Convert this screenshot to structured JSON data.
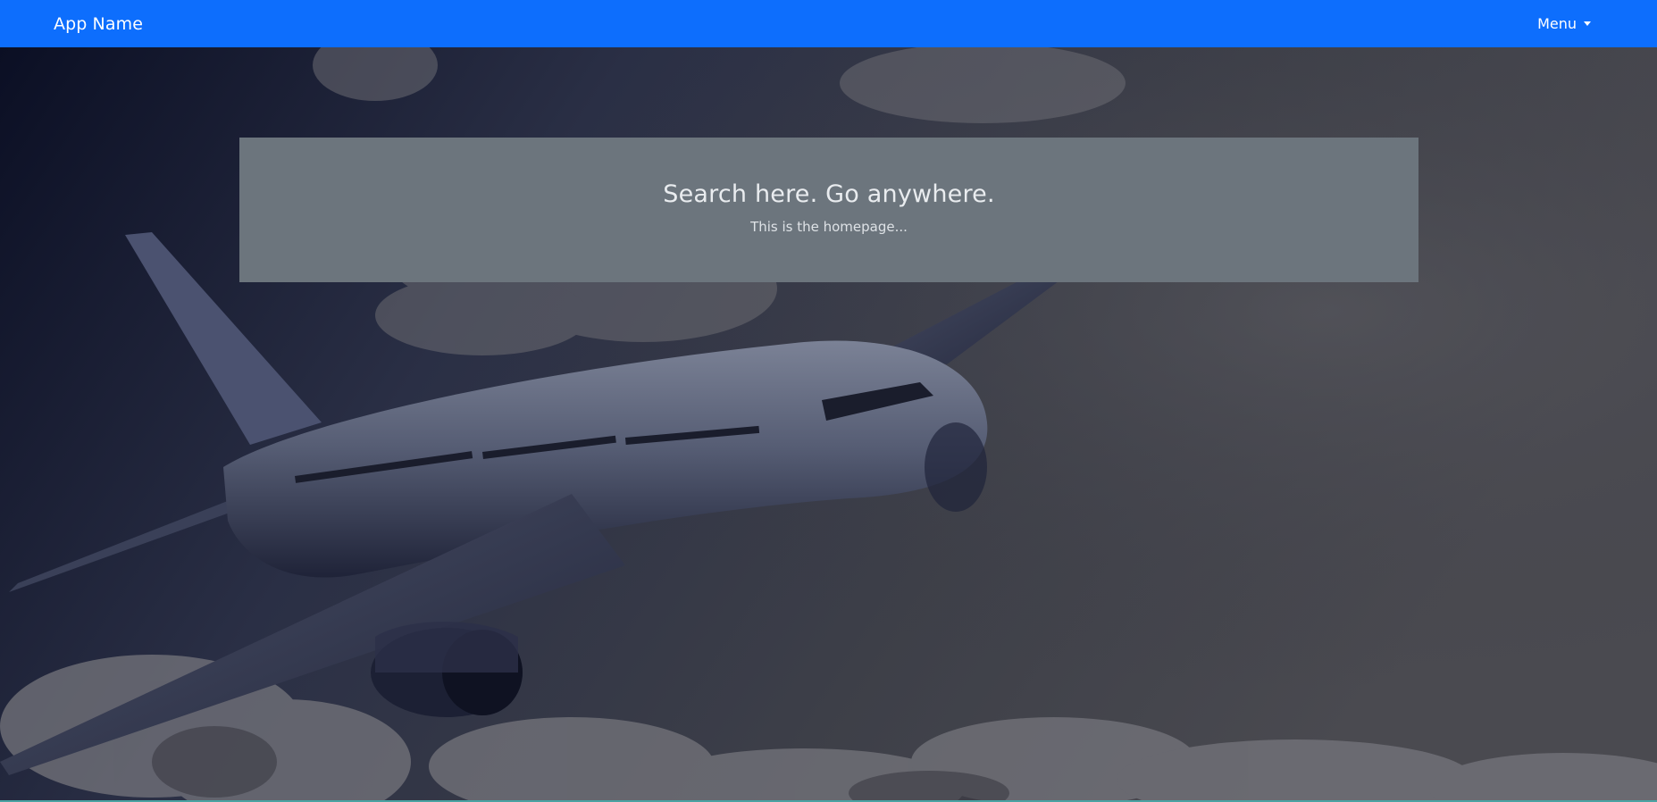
{
  "navbar": {
    "brand": "App Name",
    "menu_label": "Menu",
    "background_color": "#0d6efd"
  },
  "hero": {
    "background_image": "airplane-flying-above-clouds",
    "title": "Search here. Go anywhere.",
    "subtitle": "This is the homepage..."
  },
  "icons": {
    "menu_caret": "chevron-down-icon"
  }
}
